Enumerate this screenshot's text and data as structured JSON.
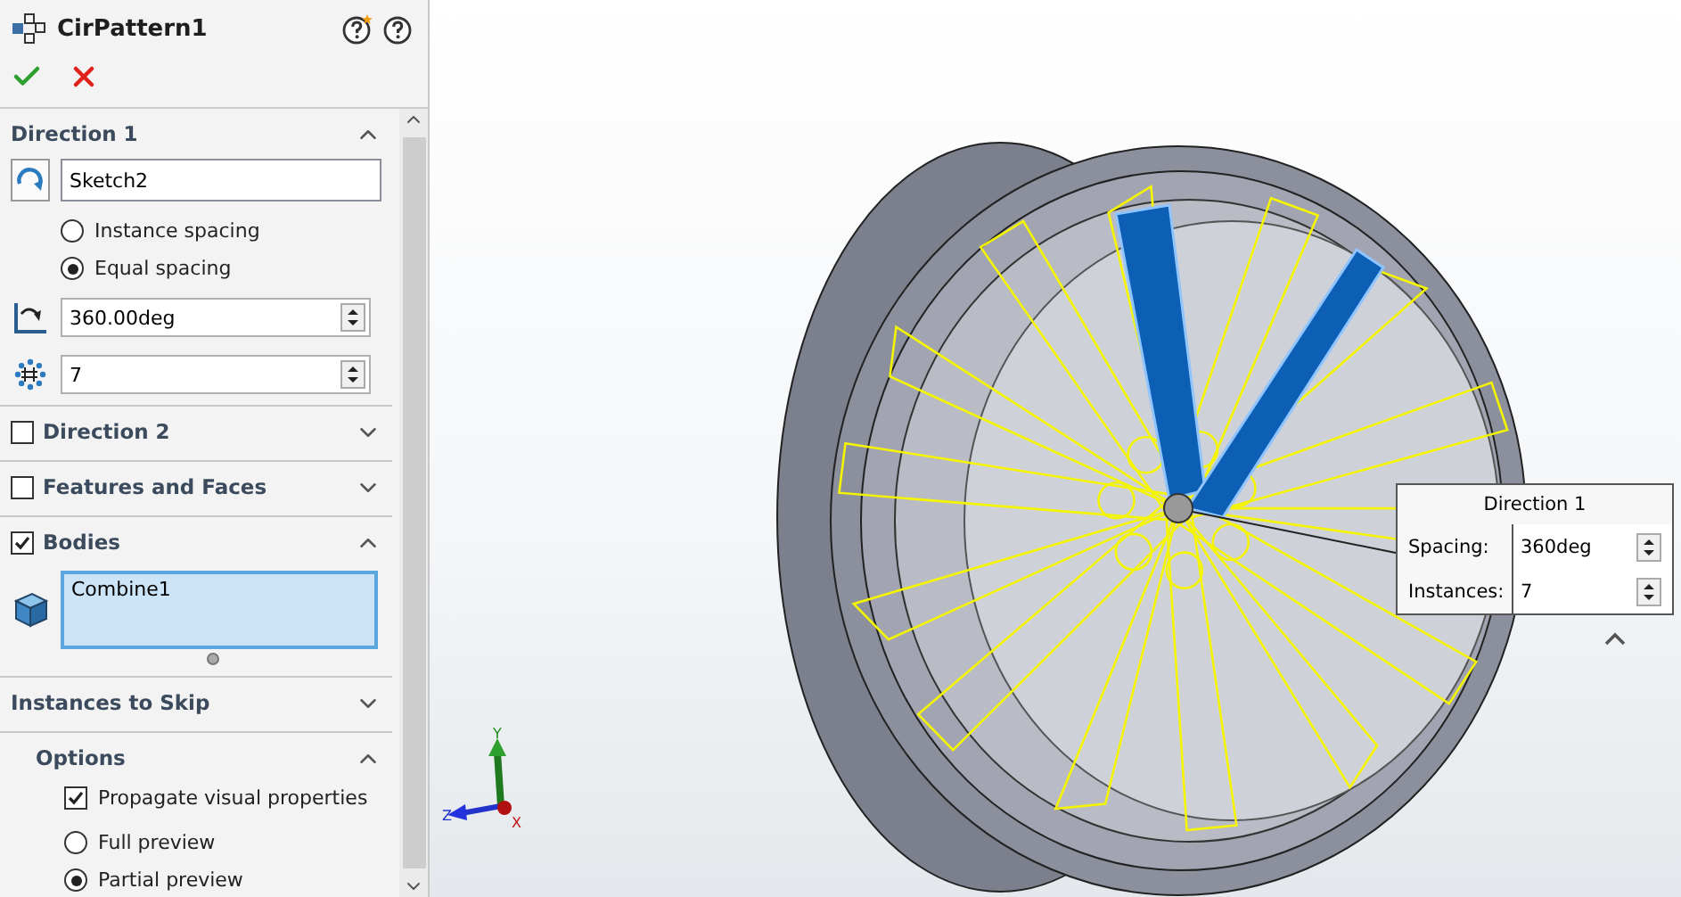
{
  "header": {
    "title": "CirPattern1"
  },
  "direction1": {
    "title": "Direction 1",
    "expanded": true,
    "reference": "Sketch2",
    "spacing_options": [
      {
        "label": "Instance spacing",
        "selected": false
      },
      {
        "label": "Equal spacing",
        "selected": true
      }
    ],
    "angle": "360.00deg",
    "instances": "7"
  },
  "sections": [
    {
      "label": "Direction 2",
      "checked": false,
      "expanded": false
    },
    {
      "label": "Features and Faces",
      "checked": false,
      "expanded": false
    }
  ],
  "bodies": {
    "label": "Bodies",
    "checked": true,
    "expanded": true,
    "items": [
      "Combine1"
    ]
  },
  "instances_to_skip": {
    "label": "Instances to Skip",
    "expanded": false
  },
  "options": {
    "title": "Options",
    "expanded": true,
    "propagate": {
      "label": "Propagate visual properties",
      "checked": true
    },
    "preview": [
      {
        "label": "Full preview",
        "selected": false
      },
      {
        "label": "Partial preview",
        "selected": true
      }
    ]
  },
  "callout": {
    "title": "Direction 1",
    "rows": [
      {
        "label": "Spacing:",
        "value": "360deg"
      },
      {
        "label": "Instances:",
        "value": "7"
      }
    ]
  },
  "triad": {
    "axes": [
      "Y",
      "Z",
      "X"
    ]
  }
}
